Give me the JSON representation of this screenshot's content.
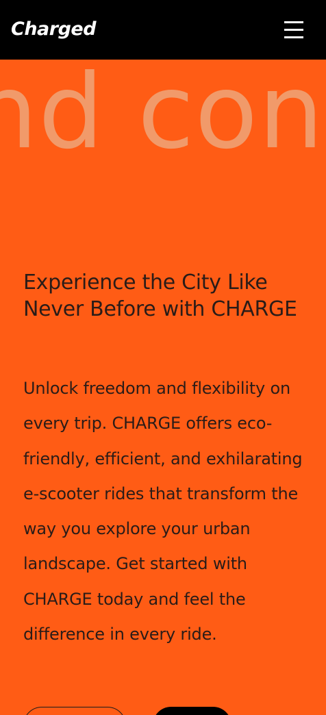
{
  "header": {
    "brand": "Charged",
    "menu_icon": "hamburger-menu-icon"
  },
  "hero": {
    "marquee_text": "nd conv",
    "headline": "Experience the City Like Never Before with CHARGE",
    "body": "Unlock freedom and flexibility on every trip. CHARGE offers eco-friendly, efficient, and exhilarating e-scooter rides that transform the way you explore your urban landscape. Get started with CHARGE today and feel the difference in every ride.",
    "cta_outline_label": "",
    "cta_solid_label": ""
  },
  "colors": {
    "header_bg": "#000000",
    "accent_orange": "#FF5C15",
    "marquee_text": "#F19A6A",
    "body_text": "#2A1C18"
  }
}
